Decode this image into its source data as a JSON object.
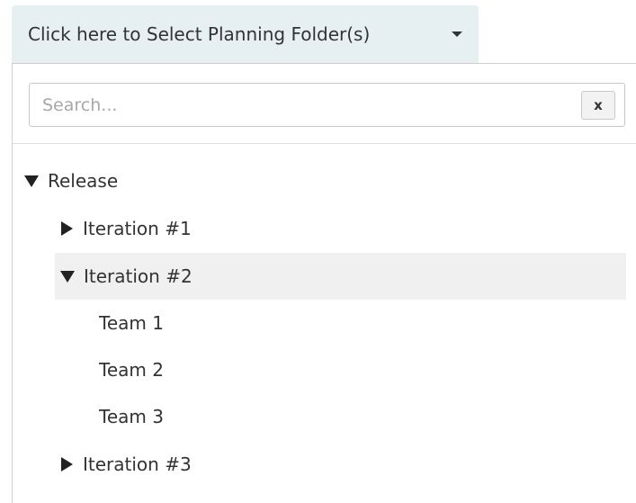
{
  "dropdown": {
    "label": "Click here to Select Planning Folder(s)",
    "caret_icon": "caret-down-icon"
  },
  "search": {
    "placeholder": "Search...",
    "value": "",
    "clear_label": "x"
  },
  "tree": {
    "release": {
      "label": "Release",
      "expanded": true,
      "icon": "triangle-down-icon"
    },
    "iteration1": {
      "label": "Iteration #1",
      "expanded": false,
      "icon": "triangle-right-icon"
    },
    "iteration2": {
      "label": "Iteration #2",
      "expanded": true,
      "icon": "triangle-down-icon",
      "highlighted": true
    },
    "team1": {
      "label": "Team 1"
    },
    "team2": {
      "label": "Team 2"
    },
    "team3": {
      "label": "Team 3"
    },
    "iteration3": {
      "label": "Iteration #3",
      "expanded": false,
      "icon": "triangle-right-icon"
    }
  },
  "colors": {
    "toggle_background": "#e6eff1",
    "highlight_row": "#f0f0f0",
    "text": "#333333",
    "placeholder": "#a8a8a8"
  }
}
